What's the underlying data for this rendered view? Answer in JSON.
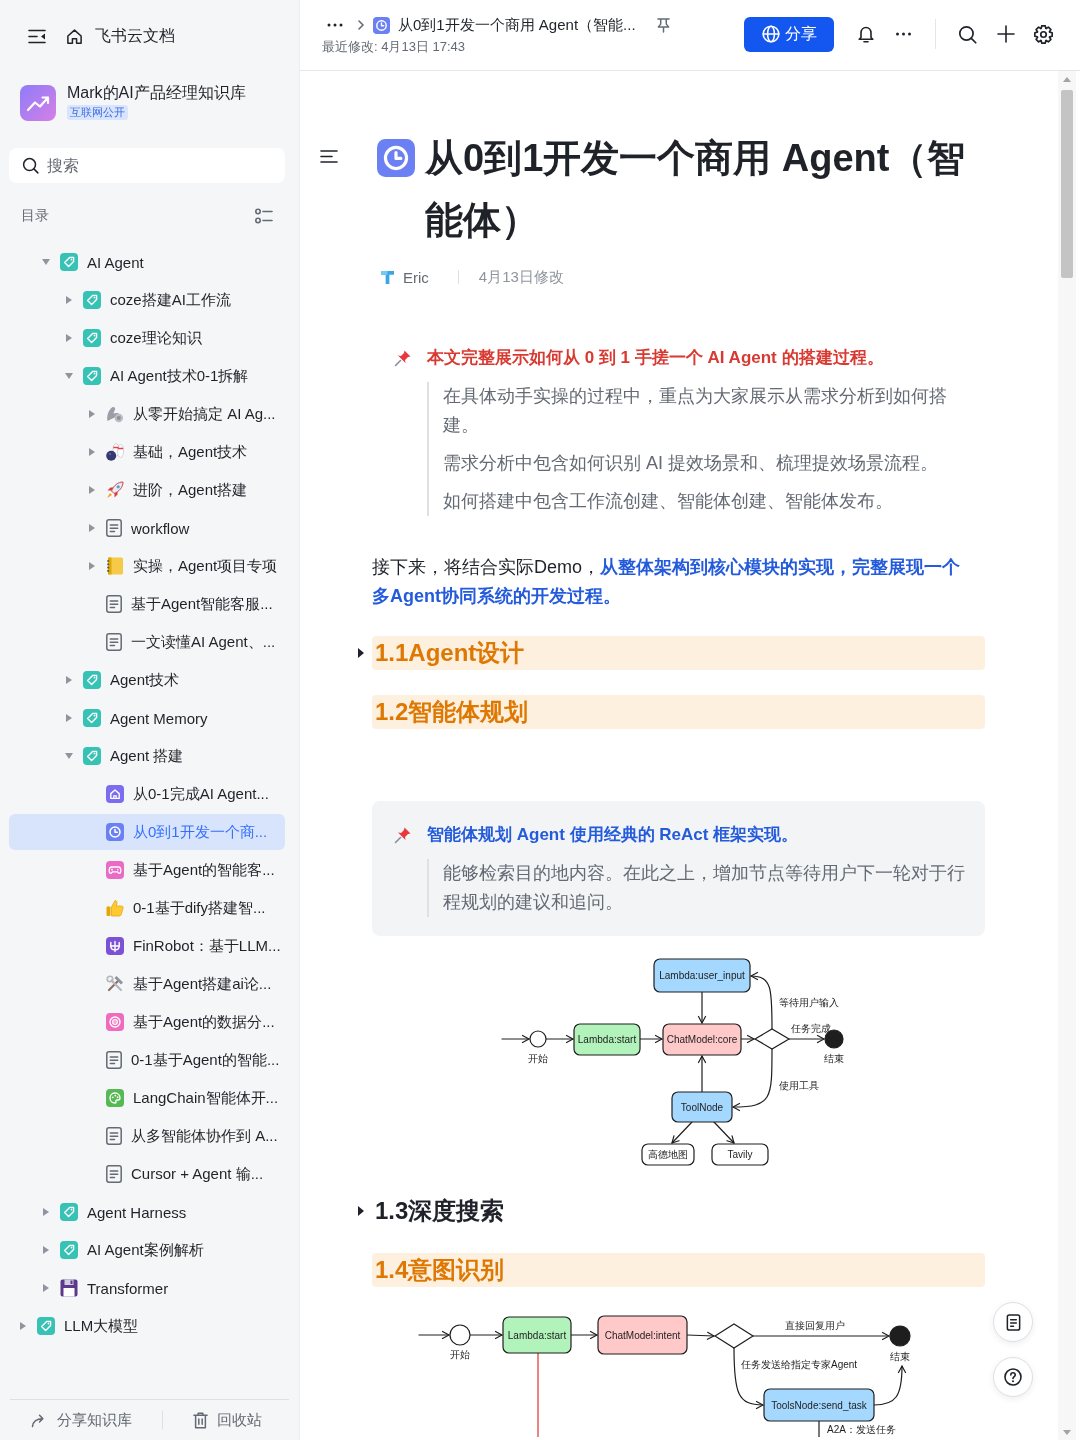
{
  "sidebar": {
    "title": "飞书云文档",
    "space": {
      "name": "Mark的AI产品经理知识库",
      "tag": "互联网公开"
    },
    "search": {
      "placeholder": "搜索"
    },
    "toc_label": "目录",
    "tree": [
      {
        "children": [
          {
            "label": "AI Agent",
            "kind": "wiki",
            "expanded": true,
            "selected": false,
            "children": [
              {
                "label": "coze搭建AI工作流",
                "kind": "wiki",
                "expanded": false,
                "selected": false
              },
              {
                "label": "coze理论知识",
                "kind": "wiki",
                "expanded": false,
                "selected": false
              },
              {
                "label": "AI Agent技术0-1拆解",
                "kind": "wiki",
                "expanded": true,
                "selected": false,
                "children": [
                  {
                    "label": "从零开始搞定 AI Ag...",
                    "kind": "biceps",
                    "expanded": false,
                    "selected": false
                  },
                  {
                    "label": "基础，Agent技术",
                    "kind": "bowling",
                    "expanded": false,
                    "selected": false
                  },
                  {
                    "label": "进阶，Agent搭建",
                    "kind": "rocket",
                    "expanded": false,
                    "selected": false
                  },
                  {
                    "label": "workflow",
                    "kind": "doc",
                    "expanded": false,
                    "selected": false
                  },
                  {
                    "label": "实操，Agent项目专项",
                    "kind": "notebook",
                    "expanded": false,
                    "selected": false
                  },
                  {
                    "label": "基于Agent智能客服...",
                    "kind": "doc",
                    "selected": false
                  },
                  {
                    "label": "一文读懂AI Agent、...",
                    "kind": "doc",
                    "selected": false
                  }
                ]
              },
              {
                "label": "Agent技术",
                "kind": "wiki",
                "expanded": false,
                "selected": false
              },
              {
                "label": "Agent Memory",
                "kind": "wiki",
                "expanded": false,
                "selected": false
              },
              {
                "label": "Agent 搭建",
                "kind": "wiki",
                "expanded": true,
                "selected": false,
                "children": [
                  {
                    "label": "从0-1完成AI Agent...",
                    "kind": "home",
                    "selected": false
                  },
                  {
                    "label": "从0到1开发一个商...",
                    "kind": "clock",
                    "selected": true
                  },
                  {
                    "label": "基于Agent的智能客...",
                    "kind": "gamepad",
                    "selected": false
                  },
                  {
                    "label": "0-1基于dify搭建智...",
                    "kind": "thumbsup",
                    "selected": false
                  },
                  {
                    "label": "FinRobot：基于LLM...",
                    "kind": "trident",
                    "selected": false
                  },
                  {
                    "label": "基于Agent搭建ai论...",
                    "kind": "tools",
                    "selected": false
                  },
                  {
                    "label": "基于Agent的数据分...",
                    "kind": "target",
                    "selected": false
                  },
                  {
                    "label": "0-1基于Agent的智能...",
                    "kind": "doc",
                    "selected": false
                  },
                  {
                    "label": "LangChain智能体开...",
                    "kind": "palette",
                    "selected": false
                  },
                  {
                    "label": "从多智能体协作到 A...",
                    "kind": "doc",
                    "selected": false
                  },
                  {
                    "label": "Cursor + Agent 输...",
                    "kind": "doc",
                    "selected": false
                  }
                ]
              }
            ]
          },
          {
            "label": "Agent Harness",
            "kind": "wiki",
            "expanded": false,
            "selected": false
          },
          {
            "label": "AI Agent案例解析",
            "kind": "wiki",
            "expanded": false,
            "selected": false
          },
          {
            "label": "Transformer",
            "kind": "floppy",
            "expanded": false,
            "selected": false
          }
        ]
      },
      {
        "label": "LLM大模型",
        "kind": "wiki",
        "expanded": false,
        "selected": false
      }
    ],
    "footer": [
      {
        "label": "分享知识库",
        "kind": "share"
      },
      {
        "label": "回收站",
        "kind": "trash"
      }
    ]
  },
  "topbar": {
    "title": "从0到1开发一个商用 Agent（智能...",
    "last_modified": "最近修改: 4月13日 17:43",
    "share": "分享"
  },
  "document": {
    "title": "从0到1开发一个商用 Agent（智能体）",
    "author": "Eric",
    "modified": "4月13日修改",
    "blocks": [
      {
        "kind": "callout",
        "filled": false,
        "color": "#d83931",
        "title": "本文完整展示如何从 0 到 1 手搓一个 AI Agent 的搭建过程。",
        "lines": [
          "在具体动手实操的过程中，重点为大家展示从需求分析到如何搭建。",
          "需求分析中包含如何识别 AI 提效场景和、梳理提效场景流程。",
          "如何搭建中包含工作流创建、智能体创建、智能体发布。"
        ]
      },
      {
        "kind": "paragraph",
        "text": "接下来，将结合实际Demo，**从整体架构到核心模块的实现，完整展现一个多Agent协同系统的开发过程。**"
      },
      {
        "kind": "heading",
        "text": "1.1Agent设计",
        "folded": true,
        "highlighted": true
      },
      {
        "kind": "heading",
        "text": "1.2智能体规划",
        "folded": false,
        "highlighted": true
      },
      {
        "kind": "callout",
        "filled": true,
        "color": "#245bdb",
        "title": "智能体规划 Agent 使用经典的 ReAct 框架实现。",
        "lines": [
          "能够检索目的地内容。在此之上，增加节点等待用户下一轮对于行程规划的建议和追问。"
        ]
      },
      {
        "kind": "diagram",
        "nodes": [
          {
            "kind": "process",
            "label": "Lambda:user_input",
            "color": "#a5d8ff"
          },
          {
            "kind": "start",
            "label": "开始"
          },
          {
            "kind": "process",
            "label": "Lambda:start",
            "color": "#b2f2bb"
          },
          {
            "kind": "process",
            "label": "ChatModel:core",
            "color": "#ffc9c9"
          },
          {
            "kind": "decision"
          },
          {
            "kind": "end",
            "label": "结束"
          },
          {
            "kind": "process",
            "label": "ToolNode",
            "color": "#a5d8ff"
          },
          {
            "kind": "process",
            "label": "高德地图"
          },
          {
            "kind": "process",
            "label": "Tavily"
          }
        ],
        "edge_labels": [
          "等待用户输入",
          "任务完成",
          "使用工具"
        ]
      },
      {
        "kind": "heading",
        "text": "1.3深度搜索",
        "folded": true,
        "highlighted": false
      },
      {
        "kind": "heading",
        "text": "1.4意图识别",
        "folded": false,
        "highlighted": true
      },
      {
        "kind": "diagram",
        "nodes": [
          {
            "kind": "start",
            "label": "开始"
          },
          {
            "kind": "process",
            "label": "Lambda:start",
            "color": "#b2f2bb"
          },
          {
            "kind": "process",
            "label": "ChatModel:intent",
            "color": "#ffc9c9"
          },
          {
            "kind": "decision"
          },
          {
            "kind": "end",
            "label": "结束"
          },
          {
            "kind": "process",
            "label": "ToolsNode:send_task",
            "color": "#a5d8ff"
          }
        ],
        "edge_labels": [
          "直接回复用户",
          "任务发送给指定专家Agent",
          "A2A：发送任务"
        ]
      }
    ]
  }
}
